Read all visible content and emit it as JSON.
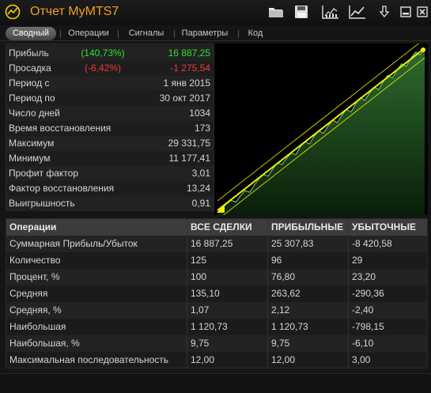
{
  "app": {
    "title": "Отчет MyMTS7"
  },
  "toolbar": {
    "buttons": [
      "folder-open-icon",
      "save-disk-icon",
      "chart-bars-icon",
      "chart-line-icon",
      "download-arrow-icon",
      "minimize-icon",
      "close-icon"
    ]
  },
  "tabs": [
    "Сводный",
    "Операции",
    "Сигналы",
    "Параметры",
    "Код"
  ],
  "active_tab": "Сводный",
  "stats": [
    {
      "label": "Прибыль",
      "pct": "(140,73%)",
      "value": "16 887,25",
      "tone": "green"
    },
    {
      "label": "Просадка",
      "pct": "(-6,42%)",
      "value": "-1 275,54",
      "tone": "red"
    },
    {
      "label": "Период с",
      "pct": "",
      "value": "1 янв 2015",
      "tone": ""
    },
    {
      "label": "Период по",
      "pct": "",
      "value": "30 окт 2017",
      "tone": ""
    },
    {
      "label": "Число дней",
      "pct": "",
      "value": "1034",
      "tone": ""
    },
    {
      "label": "Время восстановления",
      "pct": "",
      "value": "173",
      "tone": ""
    },
    {
      "label": "Максимум",
      "pct": "",
      "value": "29 331,75",
      "tone": ""
    },
    {
      "label": "Минимум",
      "pct": "",
      "value": "11 177,41",
      "tone": ""
    },
    {
      "label": "Профит фактор",
      "pct": "",
      "value": "3,01",
      "tone": ""
    },
    {
      "label": "Фактор восстановления",
      "pct": "",
      "value": "13,24",
      "tone": ""
    },
    {
      "label": "Выигрышность",
      "pct": "",
      "value": "0,91",
      "tone": ""
    }
  ],
  "ops_table": {
    "headers": [
      "Операции",
      "ВСЕ СДЕЛКИ",
      "ПРИБЫЛЬНЫЕ",
      "УБЫТОЧНЫЕ"
    ],
    "rows": [
      [
        "Суммарная Прибыль/Убыток",
        "16 887,25",
        "25 307,83",
        "-8 420,58"
      ],
      [
        "Количество",
        "125",
        "96",
        "29"
      ],
      [
        "Процент, %",
        "100",
        "76,80",
        "23,20"
      ],
      [
        "Средняя",
        "135,10",
        "263,62",
        "-290,36"
      ],
      [
        "Средняя, %",
        "1,07",
        "2,12",
        "-2,40"
      ],
      [
        "Наибольшая",
        "1 120,73",
        "1 120,73",
        "-798,15"
      ],
      [
        "Наибольшая, %",
        "9,75",
        "9,75",
        "-6,10"
      ],
      [
        "Максимальная последовательность",
        "12,00",
        "12,00",
        "3,00"
      ]
    ]
  },
  "chart_data": {
    "type": "area",
    "title": "",
    "xlabel": "",
    "ylabel": "",
    "ylim": [
      11177.41,
      29331.75
    ],
    "series": [
      {
        "values": [
          11177,
          11400,
          11900,
          12300,
          12100,
          12800,
          13400,
          13200,
          14000,
          14700,
          15200,
          15000,
          15800,
          16500,
          16300,
          17000,
          17600,
          17400,
          18300,
          18900,
          18600,
          19500,
          20100,
          19800,
          20600,
          21300,
          21000,
          21800,
          22500,
          22200,
          23100,
          23800,
          23500,
          24300,
          25000,
          24700,
          25600,
          26300,
          26000,
          26900,
          27600,
          27300,
          28200,
          28900,
          28600,
          29331
        ]
      }
    ],
    "colors": {
      "fill_top": "#2e6b2e",
      "fill_bottom": "#0a1e0a",
      "line": "#7fd07f",
      "trend": "#f0f000"
    }
  }
}
